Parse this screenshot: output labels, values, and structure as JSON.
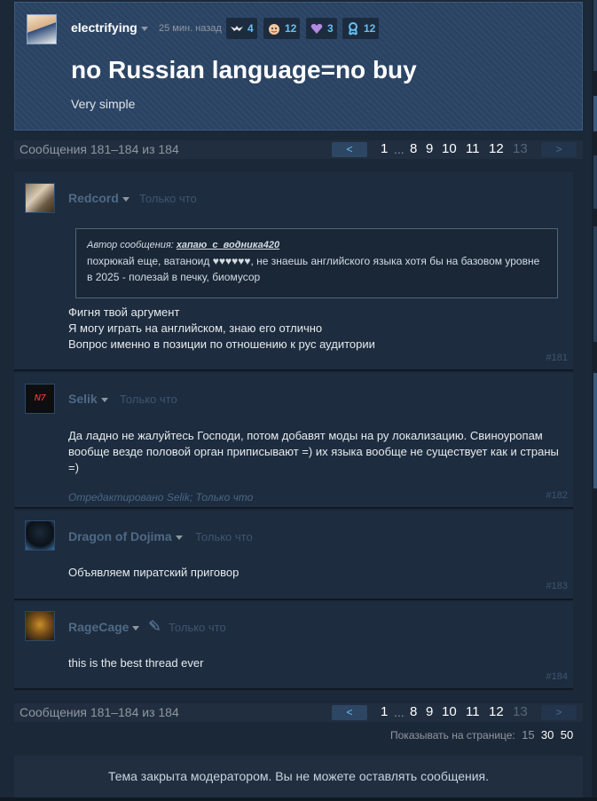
{
  "op": {
    "author": "electrifying",
    "time": "25 мин. назад",
    "badges": [
      {
        "icon": "winged-badge-icon",
        "count": "4"
      },
      {
        "icon": "smiling-face-badge-icon",
        "count": "12"
      },
      {
        "icon": "heart-badge-icon",
        "count": "3"
      },
      {
        "icon": "ribbon-badge-icon",
        "count": "12"
      }
    ],
    "title": "no Russian language=no buy",
    "body": "Very simple"
  },
  "pagination": {
    "info": "Сообщения 181–184 из 184",
    "prev": "<",
    "next": ">",
    "first": "1",
    "ellipsis": "...",
    "pages": [
      "8",
      "9",
      "10",
      "11",
      "12"
    ],
    "current": "13"
  },
  "comments": [
    {
      "author": "Redcord",
      "time": "Только что",
      "quote_label": "Автор сообщения:",
      "quote_author": "хапаю_с_водника420",
      "quote_line1": "похрюкай еще, ватаноид ♥♥♥♥♥♥, не знаешь английского языка хотя бы на базовом уровне",
      "quote_line2": "в 2025 - полезай в печку, биомусор",
      "line1": "Фигня твой аргумент",
      "line2": "Я могу играть на английском, знаю его отлично",
      "line3": "Вопрос именно в позиции по отношению к рус аудитории",
      "num": "#181"
    },
    {
      "author": "Selik",
      "time": "Только что",
      "line1": "Да ладно не жалуйтесь Господи, потом добавят моды на ру локализацию. Свиноуропам",
      "line2": "вообще везде половой орган приписывают =) их языка вообще не существует как и страны",
      "line3": "=)",
      "edited": "Отредактировано Selik; Только что",
      "avatar_text": "N7",
      "num": "#182"
    },
    {
      "author": "Dragon of Dojima",
      "time": "Только что",
      "line1": "Объявляем пиратский приговор",
      "num": "#183"
    },
    {
      "author": "RageCage",
      "time": "Только что",
      "line1": "this is the best thread ever",
      "num": "#184"
    }
  ],
  "per_page": {
    "label": "Показывать на странице:",
    "options": [
      "15",
      "30",
      "50"
    ]
  },
  "closed_notice": "Тема закрыта модератором. Вы не можете оставлять сообщения."
}
